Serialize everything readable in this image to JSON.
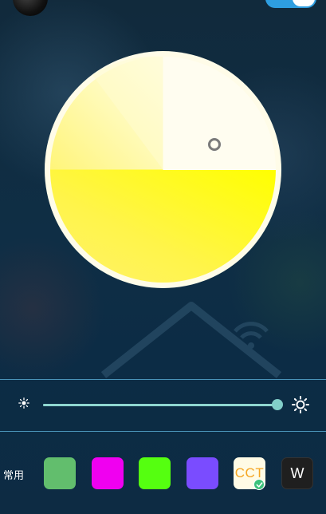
{
  "header": {
    "avatar_icon": "avatar",
    "power_toggle": {
      "state": "on",
      "color": "#2e9ee0"
    }
  },
  "color_wheel": {
    "colors": {
      "warm": "#ffff00",
      "cool": "#fffde0",
      "rim": "#fffce8"
    },
    "picker_icon": "ring-picker-icon"
  },
  "brightness": {
    "min_icon": "sun-small-icon",
    "max_icon": "sun-large-icon",
    "value": 1.0,
    "track_color": "#79c9c5"
  },
  "presets": {
    "label": "常用",
    "swatches": [
      {
        "name": "green",
        "color": "#62be6d"
      },
      {
        "name": "magenta",
        "color": "#f000f0"
      },
      {
        "name": "lime",
        "color": "#55ff10"
      },
      {
        "name": "violet",
        "color": "#7a4cff"
      },
      {
        "name": "cct",
        "label": "CCT",
        "color": "#fffbe6",
        "selected": true
      },
      {
        "name": "white",
        "label": "W",
        "color": "#1f1f1f"
      }
    ]
  }
}
